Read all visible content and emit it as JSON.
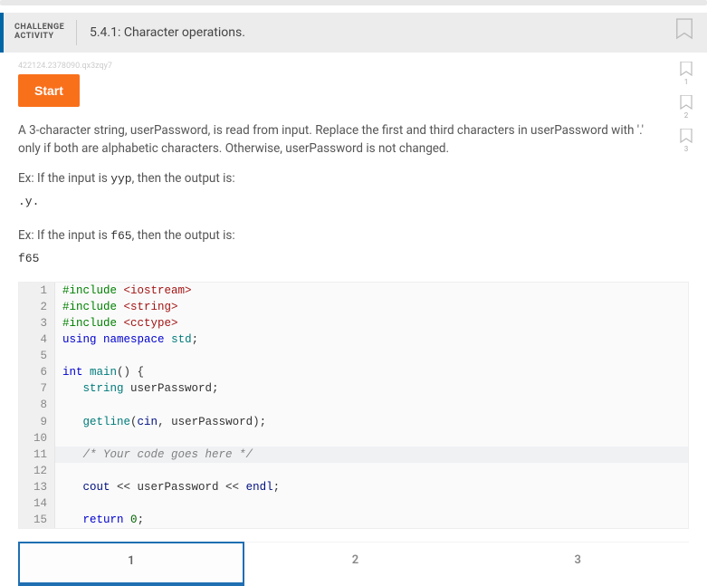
{
  "header": {
    "badge_line1": "CHALLENGE",
    "badge_line2": "ACTIVITY",
    "title": "5.4.1: Character operations."
  },
  "side_bookmarks": [
    "1",
    "2",
    "3"
  ],
  "hash": "422124.2378090.qx3zqy7",
  "start_label": "Start",
  "description": "A 3-character string, userPassword, is read from input. Replace the first and third characters in userPassword with '.' only if both are alphabetic characters. Otherwise, userPassword is not changed.",
  "ex1_prefix": "Ex: If the input is ",
  "ex1_input": "yyp",
  "ex1_suffix": ", then the output is:",
  "ex1_output": ".y.",
  "ex2_prefix": "Ex: If the input is ",
  "ex2_input": "f65",
  "ex2_suffix": ", then the output is:",
  "ex2_output": "f65",
  "code": {
    "lines": [
      {
        "n": "1",
        "html": "<span class='kw-pre'>#include</span> <span class='kw-str'>&lt;iostream&gt;</span>"
      },
      {
        "n": "2",
        "html": "<span class='kw-pre'>#include</span> <span class='kw-str'>&lt;string&gt;</span>"
      },
      {
        "n": "3",
        "html": "<span class='kw-pre'>#include</span> <span class='kw-str'>&lt;cctype&gt;</span>"
      },
      {
        "n": "4",
        "html": "<span class='kw-blue'>using</span> <span class='kw-blue'>namespace</span> <span class='kw-teal'>std</span>;"
      },
      {
        "n": "5",
        "html": ""
      },
      {
        "n": "6",
        "html": "<span class='kw-blue'>int</span> <span class='kw-teal'>main</span>() {"
      },
      {
        "n": "7",
        "html": "   <span class='kw-teal'>string</span> userPassword;"
      },
      {
        "n": "8",
        "html": ""
      },
      {
        "n": "9",
        "html": "   <span class='kw-teal'>getline</span>(<span class='kw-navy'>cin</span>, userPassword);"
      },
      {
        "n": "10",
        "html": ""
      },
      {
        "n": "11",
        "html": "   <span class='kw-cmt'>/* Your code goes here */</span>",
        "hl": true
      },
      {
        "n": "12",
        "html": ""
      },
      {
        "n": "13",
        "html": "   <span class='kw-navy'>cout</span> &lt;&lt; userPassword &lt;&lt; <span class='kw-navy'>endl</span>;"
      },
      {
        "n": "14",
        "html": ""
      },
      {
        "n": "15",
        "html": "   <span class='kw-blue'>return</span> <span class='kw-num'>0</span>;"
      }
    ]
  },
  "tabs": [
    "1",
    "2",
    "3"
  ],
  "active_tab": 0
}
